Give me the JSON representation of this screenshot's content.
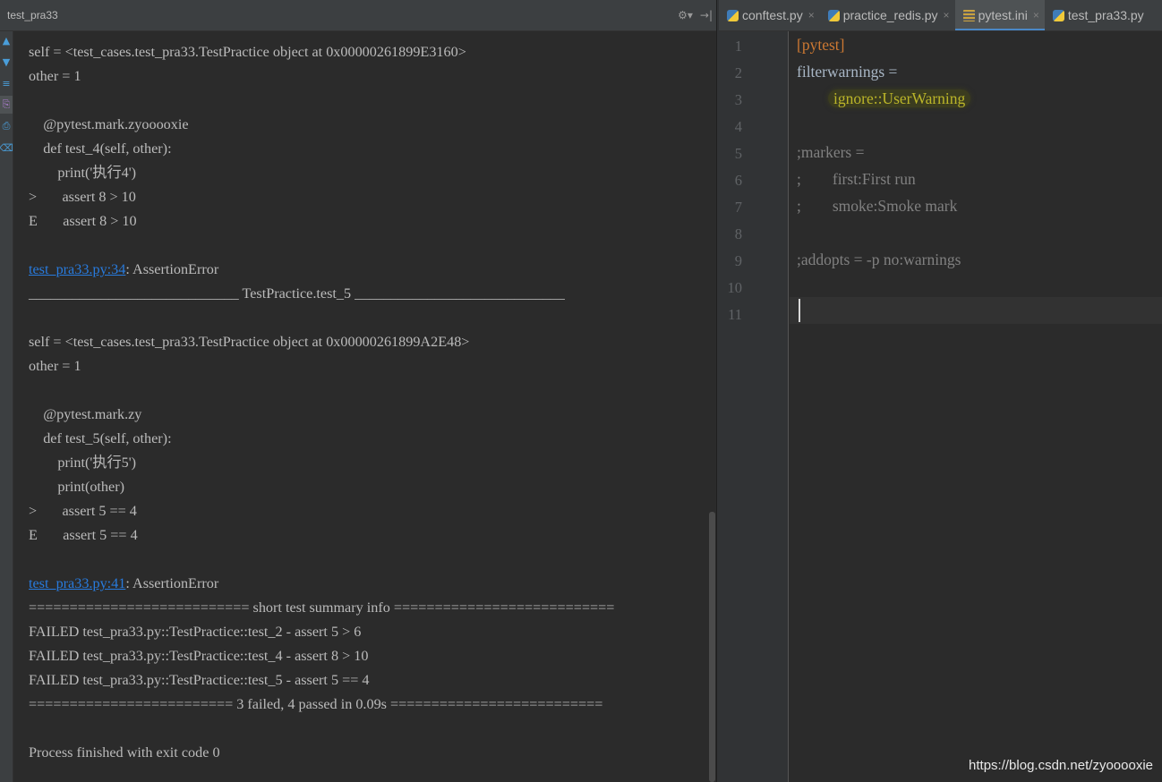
{
  "run_panel": {
    "tab_label": "test_pra33",
    "settings_label": "⚙▾",
    "hide_label": "→|"
  },
  "console": {
    "lines": [
      "self = <test_cases.test_pra33.TestPractice object at 0x00000261899E3160>",
      "other = 1",
      "",
      "    @pytest.mark.zyooooxie",
      "    def test_4(self, other):",
      "        print('执行4')",
      ">       assert 8 > 10",
      "E       assert 8 > 10",
      "",
      "__link1__",
      "_____________________________ TestPractice.test_5 _____________________________",
      "",
      "self = <test_cases.test_pra33.TestPractice object at 0x00000261899A2E48>",
      "other = 1",
      "",
      "    @pytest.mark.zy",
      "    def test_5(self, other):",
      "        print('执行5')",
      "        print(other)",
      ">       assert 5 == 4",
      "E       assert 5 == 4",
      "",
      "__link2__",
      "=========================== short test summary info ===========================",
      "FAILED test_pra33.py::TestPractice::test_2 - assert 5 > 6",
      "FAILED test_pra33.py::TestPractice::test_4 - assert 8 > 10",
      "FAILED test_pra33.py::TestPractice::test_5 - assert 5 == 4",
      "========================= 3 failed, 4 passed in 0.09s ==========================",
      "",
      "Process finished with exit code 0"
    ],
    "link1": {
      "file": "test_pra33.py:34",
      "rest": ": AssertionError"
    },
    "link2": {
      "file": "test_pra33.py:41",
      "rest": ": AssertionError"
    }
  },
  "editor": {
    "tabs": [
      {
        "label": "conftest.py",
        "icon": "python-file-icon",
        "active": false,
        "close": "×"
      },
      {
        "label": "practice_redis.py",
        "icon": "python-file-icon",
        "active": false,
        "close": "×"
      },
      {
        "label": "pytest.ini",
        "icon": "ini-file-icon",
        "active": true,
        "close": "×"
      },
      {
        "label": "test_pra33.py",
        "icon": "python-file-icon",
        "active": false,
        "close": ""
      }
    ],
    "line_numbers": [
      "1",
      "2",
      "3",
      "4",
      "5",
      "6",
      "7",
      "8",
      "9",
      "10",
      "11"
    ],
    "code": [
      {
        "text": "[pytest]",
        "style": "section"
      },
      {
        "text": "filterwarnings =",
        "style": "plain"
      },
      {
        "text": "        ",
        "style": "plain",
        "highlight": "ignore::UserWarning"
      },
      {
        "text": "",
        "style": "plain"
      },
      {
        "text": ";markers =",
        "style": "comment"
      },
      {
        "text": ";        first:First run",
        "style": "comment"
      },
      {
        "text": ";        smoke:Smoke mark",
        "style": "comment"
      },
      {
        "text": "",
        "style": "plain"
      },
      {
        "text": ";addopts = -p no:warnings",
        "style": "comment"
      },
      {
        "text": "",
        "style": "plain"
      },
      {
        "text": "",
        "style": "plain"
      }
    ]
  },
  "watermark": "https://blog.csdn.net/zyooooxie",
  "colors": {
    "background": "#2b2b2b",
    "panel_header": "#3c3f41",
    "link": "#287bde",
    "ini_section": "#cc7832",
    "comment": "#808080",
    "highlight_text": "#bbb529",
    "active_tab_underline": "#4a88c7"
  }
}
